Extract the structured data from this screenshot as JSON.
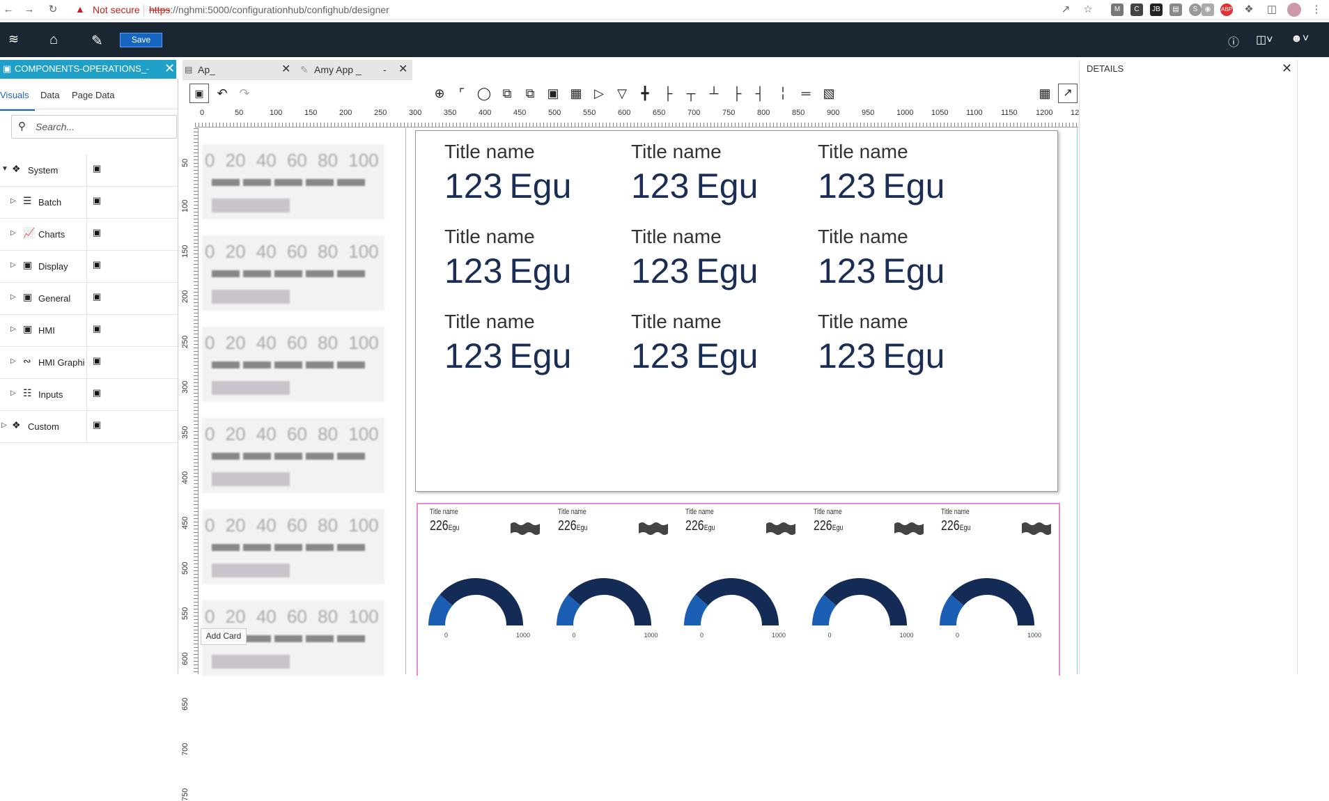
{
  "browser": {
    "not_secure": "Not secure",
    "url_scheme": "https",
    "url_rest": "://nghmi:5000/configurationhub/confighub/designer"
  },
  "header": {
    "save_label": "Save"
  },
  "left_panel": {
    "title": "COMPONENTS-OPERATIONS_-",
    "tabs": [
      "Visuals",
      "Data",
      "Page Data"
    ],
    "search_placeholder": "Search...",
    "tree": [
      {
        "label": "System",
        "icon": "components-icon",
        "expanded": true
      },
      {
        "label": "Batch",
        "icon": "layers-icon"
      },
      {
        "label": "Charts",
        "icon": "chart-icon"
      },
      {
        "label": "Display",
        "icon": "monitor-icon"
      },
      {
        "label": "General",
        "icon": "monitor-icon"
      },
      {
        "label": "HMI",
        "icon": "monitor-icon"
      },
      {
        "label": "HMI Graphi",
        "icon": "vector-icon"
      },
      {
        "label": "Inputs",
        "icon": "inputs-icon"
      },
      {
        "label": "Custom",
        "icon": "components-icon"
      }
    ]
  },
  "doc_tabs": [
    {
      "label": "Ap_"
    },
    {
      "label": "Amy App _",
      "suffix": "-"
    }
  ],
  "ruler": {
    "top": [
      "0",
      "50",
      "100",
      "150",
      "200",
      "250",
      "300",
      "350",
      "400",
      "450",
      "500",
      "550",
      "600",
      "650",
      "700",
      "750",
      "800",
      "850",
      "900",
      "950",
      "1000",
      "1050",
      "1100",
      "1150",
      "1200",
      "12"
    ],
    "left": [
      "50",
      "100",
      "150",
      "200",
      "250",
      "300",
      "350",
      "400",
      "450",
      "500",
      "550",
      "600",
      "650",
      "700",
      "750"
    ]
  },
  "library": {
    "scale_numbers": "0 20 40 60 80 100",
    "add_card_tooltip": "Add Card"
  },
  "kpi_cards": [
    {
      "title": "Title name",
      "value": "123",
      "unit": "Egu"
    },
    {
      "title": "Title name",
      "value": "123",
      "unit": "Egu"
    },
    {
      "title": "Title name",
      "value": "123",
      "unit": "Egu"
    },
    {
      "title": "Title name",
      "value": "123",
      "unit": "Egu"
    },
    {
      "title": "Title name",
      "value": "123",
      "unit": "Egu"
    },
    {
      "title": "Title name",
      "value": "123",
      "unit": "Egu"
    },
    {
      "title": "Title name",
      "value": "123",
      "unit": "Egu"
    },
    {
      "title": "Title name",
      "value": "123",
      "unit": "Egu"
    },
    {
      "title": "Title name",
      "value": "123",
      "unit": "Egu"
    }
  ],
  "gauges": [
    {
      "title": "Title name",
      "value": "226",
      "unit": "Egu",
      "min": "0",
      "max": "1000",
      "fraction": 0.226
    },
    {
      "title": "Title name",
      "value": "226",
      "unit": "Egu",
      "min": "0",
      "max": "1000",
      "fraction": 0.226
    },
    {
      "title": "Title name",
      "value": "226",
      "unit": "Egu",
      "min": "0",
      "max": "1000",
      "fraction": 0.226
    },
    {
      "title": "Title name",
      "value": "226",
      "unit": "Egu",
      "min": "0",
      "max": "1000",
      "fraction": 0.226
    },
    {
      "title": "Title name",
      "value": "226",
      "unit": "Egu",
      "min": "0",
      "max": "1000",
      "fraction": 0.226
    }
  ],
  "details": {
    "title": "DETAILS"
  },
  "colors": {
    "header_bg": "#1a2733",
    "panel_tab": "#1fa0c8",
    "kpi_value": "#1a2e55",
    "gauge_dark": "#142c55",
    "gauge_fill": "#1b5fb4",
    "gauge_border": "#e58ad6"
  }
}
